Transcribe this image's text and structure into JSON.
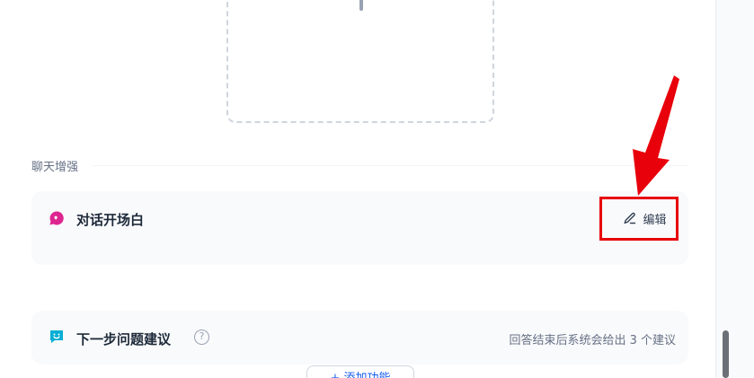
{
  "section": {
    "label": "聊天增强"
  },
  "opener": {
    "title": "对话开场白",
    "edit_label": "编辑"
  },
  "suggest": {
    "title": "下一步问题建议",
    "help_glyph": "?",
    "description": "回答结束后系统会给出 3 个建议"
  },
  "add_button": {
    "label": "+ 添加功能"
  },
  "colors": {
    "opener_icon": "#dd2590",
    "suggest_icon": "#06aed4",
    "annotation_red": "#e8000b"
  }
}
